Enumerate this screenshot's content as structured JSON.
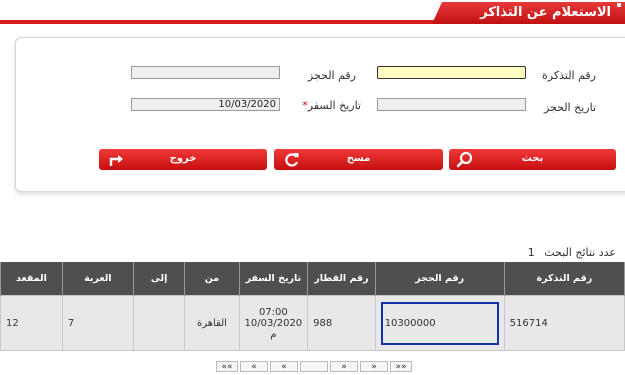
{
  "header": {
    "title": "الاستعلام عن التذاكر"
  },
  "form": {
    "ticket_number_label": "رقم التذكرة",
    "ticket_number_value": "",
    "pnr_label": "رقم الحجز",
    "pnr_value": "",
    "booking_date_label": "تاريخ الحجز",
    "booking_date_value": "",
    "travel_date_label": "تاريخ السفر",
    "travel_date_required": "*",
    "travel_date_value": "10/03/2020"
  },
  "buttons": {
    "search": "بحث",
    "clear": "مسح",
    "exit": "خروج"
  },
  "results": {
    "count_label": "عدد نتائج البحث",
    "count": "1",
    "columns": [
      "رقم التذكرة",
      "رقم الحجز",
      "رقم القطار",
      "تاريخ السفر",
      "من",
      "إلى",
      "العربة",
      "المقعد"
    ],
    "rows": [
      {
        "ticket": "516714",
        "pnr": "10300000",
        "train": "988",
        "travel_date": "10/03/2020",
        "travel_time": "07:00",
        "travel_ampm": "م",
        "from": "القاهرة",
        "to": "",
        "coach": "7",
        "seat": "12"
      }
    ]
  },
  "pager": [
    "««",
    "«",
    "«",
    "",
    "»",
    "»",
    "»»"
  ],
  "colors": {
    "accent": "#d71a1a",
    "header_bg": "#4f4f4f",
    "row_bg": "#e8e8e8",
    "highlight_border": "#1432a8",
    "active_input": "#ffffc0"
  }
}
